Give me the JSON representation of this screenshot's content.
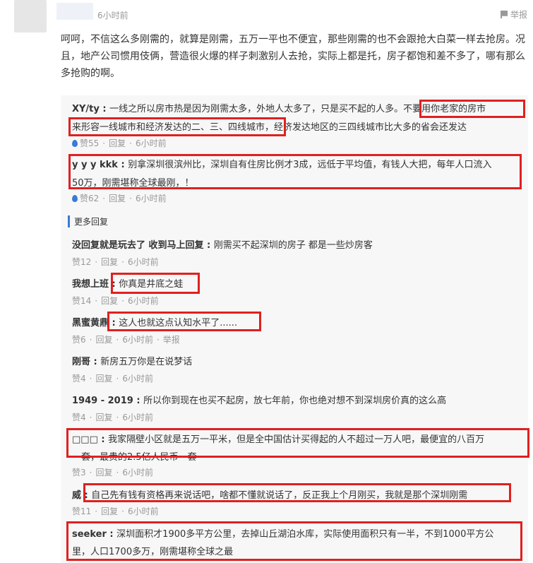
{
  "top_comment": {
    "time": "6小时前",
    "report_label": "举报",
    "text_l1": "呵呵，不信这么多刚需的，就算是刚需，五万一平也不便宜，那些刚需的也不会跟抢大白菜一样去抢房。况",
    "text_l2": "且，地产公司惯用伎俩，营造很火爆的样子刺激别人去抢，实际上都是托，房子都饱和差不多了，哪有那么",
    "text_l3": "多抢购的啊。"
  },
  "replies": [
    {
      "user": "XY/ty",
      "line1": "一线之所以房市热是因为刚需太多，外地人太多了，只是买不起的人多。不要用你老家的房市",
      "line2": "来形容一线城市和经济发达的二、三、四线城市，经济发达地区的三四线城市比大多的省会还发达",
      "likes": "赞55",
      "reply": "回复",
      "time": "6小时前"
    },
    {
      "user": "y y y kkk",
      "line1": "别拿深圳很滨州比，深圳自有住房比例才3成，远低于平均值，有钱人大把，每年人口流入",
      "line2": "50万，刚需堪称全球最刚，！",
      "likes": "赞62",
      "reply": "回复",
      "time": "6小时前"
    }
  ],
  "more_replies_label": "更多回复",
  "more_replies": [
    {
      "user": "没回复就是玩去了 收到马上回复",
      "text": "刚需买不起深圳的房子 都是一些炒房客",
      "likes": "赞12",
      "reply": "回复",
      "time": "6小时前",
      "report": ""
    },
    {
      "user": "我想上班",
      "text": "你真是井底之蛙",
      "likes": "赞14",
      "reply": "回复",
      "time": "6小时前",
      "report": ""
    },
    {
      "user": "黑蜜黄鼎",
      "text": "这人也就这点认知水平了......",
      "likes": "赞6",
      "reply": "回复",
      "time": "6小时前",
      "report": "举报"
    },
    {
      "user": "刚哥",
      "text": "新房五万你是在说梦话",
      "likes": "赞4",
      "reply": "回复",
      "time": "6小时前",
      "report": ""
    },
    {
      "user": "1949 - 2019",
      "text": "所以你到现在也买不起房，放七年前，你也绝对想不到深圳房价真的这么高",
      "likes": "赞4",
      "reply": "回复",
      "time": "6小时前",
      "report": ""
    },
    {
      "user": "□□□",
      "text": "我家隔壁小区就是五万一平米，但是全中国估计买得起的人不超过一万人吧，最便宜的八百万",
      "text2": "一套，最贵的2.5亿人民币一套",
      "likes": "赞3",
      "reply": "回复",
      "time": "6小时前",
      "report": ""
    },
    {
      "user": "威",
      "text": "自己先有钱有资格再来说话吧，啥都不懂就说话了，反正我上个月刚买，我就是那个深圳刚需",
      "likes": "赞11",
      "reply": "回复",
      "time": "6小时前",
      "report": ""
    },
    {
      "user": "seeker",
      "text": "深圳面积才1900多平方公里，去掉山丘湖泊水库，实际使用面积只有一半，不到1000平方公",
      "text2": "里，人口1700多万，刚需堪称全球之最",
      "likes": "",
      "reply": "",
      "time": "",
      "report": ""
    }
  ],
  "colors": {
    "highlight_box": "#e02020",
    "accent": "#3a7bd5"
  }
}
